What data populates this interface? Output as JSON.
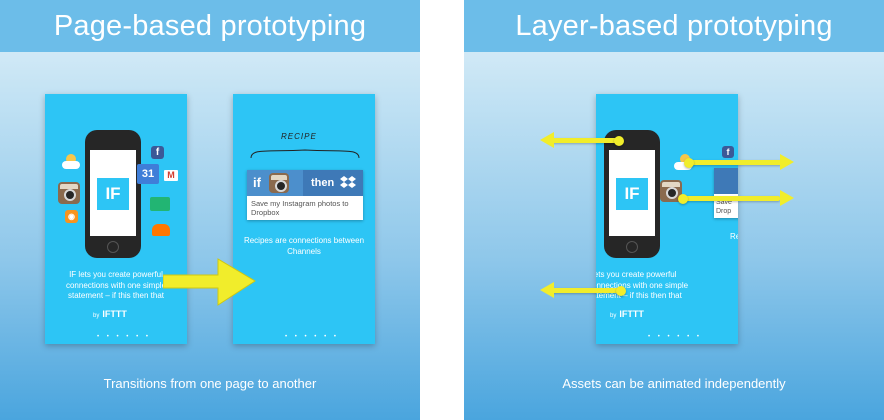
{
  "left_panel": {
    "title": "Page-based prototyping",
    "caption": "Transitions from one page to another",
    "screen1": {
      "logo": "IF",
      "text": "IF lets you create powerful connections with one simple statement – if this then that",
      "by": "by",
      "brand": "IFTTT",
      "calendar_day": "31",
      "dots": "• • • • • •"
    },
    "screen2": {
      "recipe_label": "RECIPE",
      "recipe_if": "if",
      "recipe_then": "then",
      "recipe_text": "Save my Instagram photos to Dropbox",
      "text": "Recipes are connections between Channels",
      "dots": "• • • • • •"
    }
  },
  "right_panel": {
    "title": "Layer-based prototyping",
    "caption": "Assets can be animated independently",
    "screen": {
      "logo": "IF",
      "text": "lets you create powerful onnections with one simple atement – if this then that",
      "by": "by",
      "brand": "IFTTT",
      "partial_text": "Save\nDrop",
      "partial_re": "Re",
      "dots": "• • • • • •"
    }
  },
  "colors": {
    "header": "#6cbde9",
    "screen": "#2dc5f5",
    "arrow": "#f1ed2b"
  },
  "icons": [
    "weather-icon",
    "instagram-icon",
    "rss-icon",
    "facebook-icon",
    "calendar-icon",
    "gmail-icon",
    "soundcloud-icon",
    "dropbox-icon",
    "arrow-icon"
  ]
}
